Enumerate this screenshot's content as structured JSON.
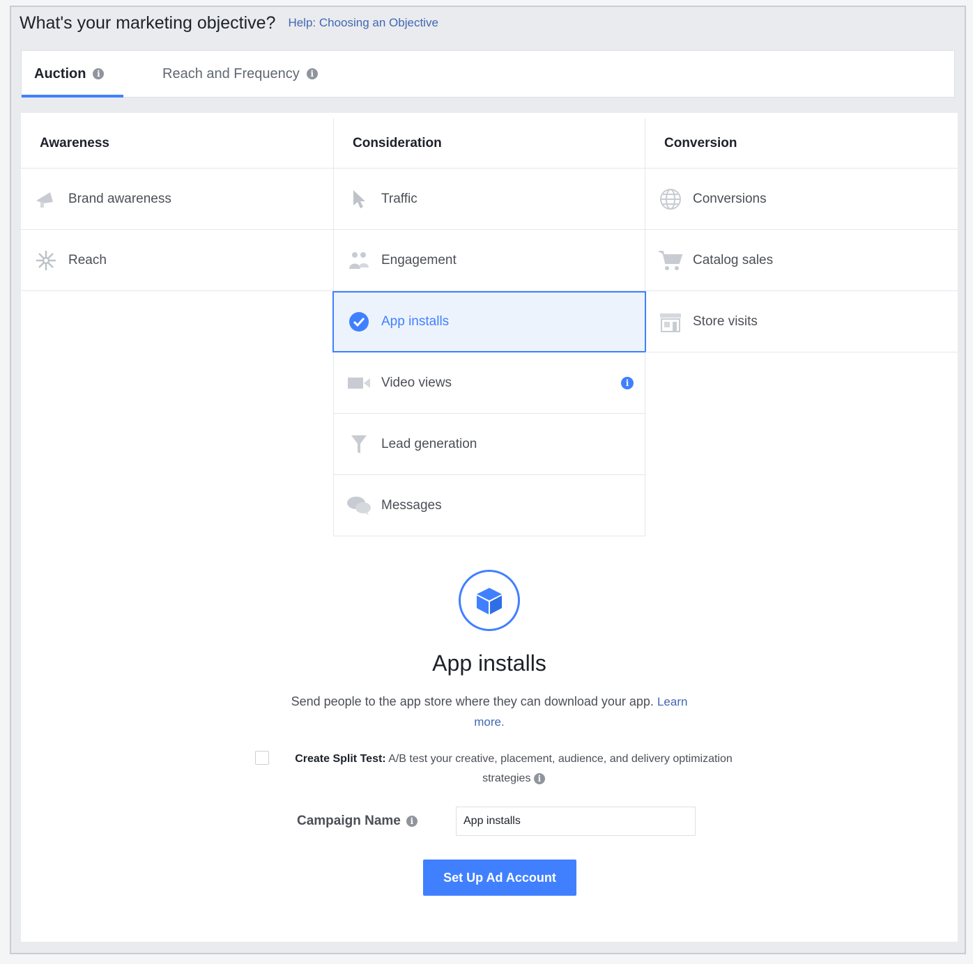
{
  "header": {
    "title": "What's your marketing objective?",
    "help_link": "Help: Choosing an Objective"
  },
  "tabs": [
    {
      "label": "Auction",
      "selected": true
    },
    {
      "label": "Reach and Frequency",
      "selected": false
    }
  ],
  "columns": {
    "awareness": {
      "heading": "Awareness",
      "items": [
        {
          "label": "Brand awareness",
          "icon": "megaphone-icon"
        },
        {
          "label": "Reach",
          "icon": "reach-icon"
        }
      ]
    },
    "consideration": {
      "heading": "Consideration",
      "items": [
        {
          "label": "Traffic",
          "icon": "cursor-icon"
        },
        {
          "label": "Engagement",
          "icon": "people-icon"
        },
        {
          "label": "App installs",
          "icon": "check-circle-icon",
          "selected": true
        },
        {
          "label": "Video views",
          "icon": "video-camera-icon",
          "has_info": true
        },
        {
          "label": "Lead generation",
          "icon": "funnel-icon"
        },
        {
          "label": "Messages",
          "icon": "chat-bubbles-icon"
        }
      ]
    },
    "conversion": {
      "heading": "Conversion",
      "items": [
        {
          "label": "Conversions",
          "icon": "globe-icon"
        },
        {
          "label": "Catalog sales",
          "icon": "cart-icon"
        },
        {
          "label": "Store visits",
          "icon": "store-icon"
        }
      ]
    }
  },
  "detail": {
    "icon": "app-cube-icon",
    "title": "App installs",
    "description": "Send people to the app store where they can download your app.",
    "learn_more": "Learn",
    "learn_more_2": "more.",
    "split_test_label": "Create Split Test:",
    "split_test_text": "A/B test your creative, placement, audience, and delivery optimization strategies",
    "split_test_checked": false,
    "campaign_name_label": "Campaign Name",
    "campaign_name_value": "App installs",
    "submit_button": "Set Up Ad Account"
  },
  "colors": {
    "accent": "#4080ff",
    "link": "#4267b2",
    "selected_bg": "#edf3fd"
  }
}
